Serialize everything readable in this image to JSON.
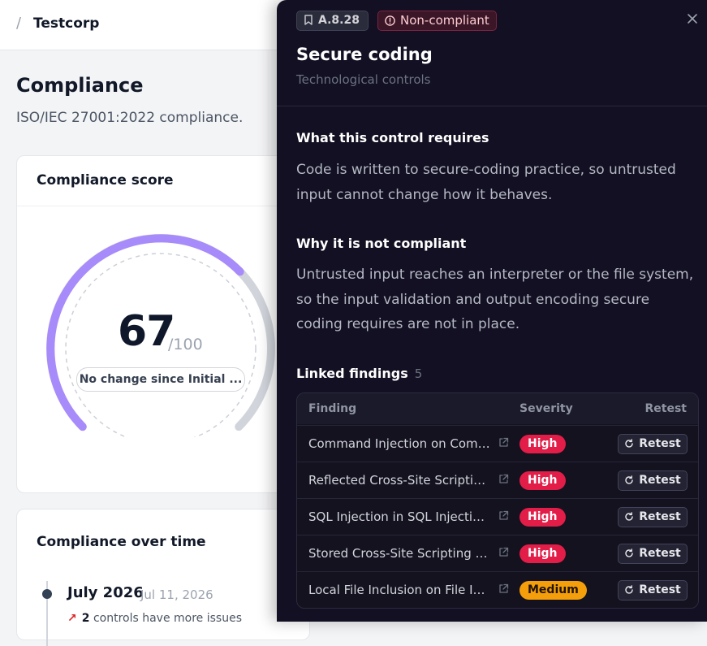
{
  "breadcrumb": {
    "separator": "/",
    "org": "Testcorp"
  },
  "page": {
    "title": "Compliance",
    "subtitle": "ISO/IEC 27001:2022 compliance."
  },
  "score_card": {
    "title": "Compliance score",
    "score": "67",
    "max": "/100",
    "score_fraction": 0.67,
    "change_label": "No change since Initial ..."
  },
  "over_time_card": {
    "title": "Compliance over time",
    "entries": [
      {
        "month": "July 2026",
        "date": "Jul 11, 2026",
        "count": "2",
        "issue_text": "controls have more issues"
      }
    ]
  },
  "drawer": {
    "control_id": "A.8.28",
    "status": "Non-compliant",
    "title": "Secure coding",
    "category": "Technological controls",
    "requires_heading": "What this control requires",
    "requires_text": "Code is written to secure-coding practice, so untrusted input cannot change how it behaves.",
    "why_heading": "Why it is not compliant",
    "why_text": "Untrusted input reaches an interpreter or the file system, so the input validation and output encoding secure coding requires are not in place.",
    "linked_heading": "Linked findings",
    "linked_count": "5",
    "table_headers": {
      "finding": "Finding",
      "severity": "Severity",
      "retest": "Retest"
    },
    "findings": [
      {
        "name": "Command Injection on Comm...",
        "severity": "High",
        "retest": "Retest"
      },
      {
        "name": "Reflected Cross-Site Scriptin...",
        "severity": "High",
        "retest": "Retest"
      },
      {
        "name": "SQL Injection in SQL Injection ...",
        "severity": "High",
        "retest": "Retest"
      },
      {
        "name": "Stored Cross-Site Scripting (X...",
        "severity": "High",
        "retest": "Retest"
      },
      {
        "name": "Local File Inclusion on File Inc...",
        "severity": "Medium",
        "retest": "Retest"
      }
    ]
  },
  "colors": {
    "accent_purple": "#a78bfa",
    "high": "#e11d48",
    "medium": "#f59e0b",
    "drawer_bg": "#121022"
  },
  "icons": {
    "control_id": "bookmark-icon",
    "status": "alert-circle-icon",
    "close": "close-icon",
    "external_link": "external-link-icon",
    "retest": "refresh-icon",
    "trend": "trend-up-icon"
  }
}
